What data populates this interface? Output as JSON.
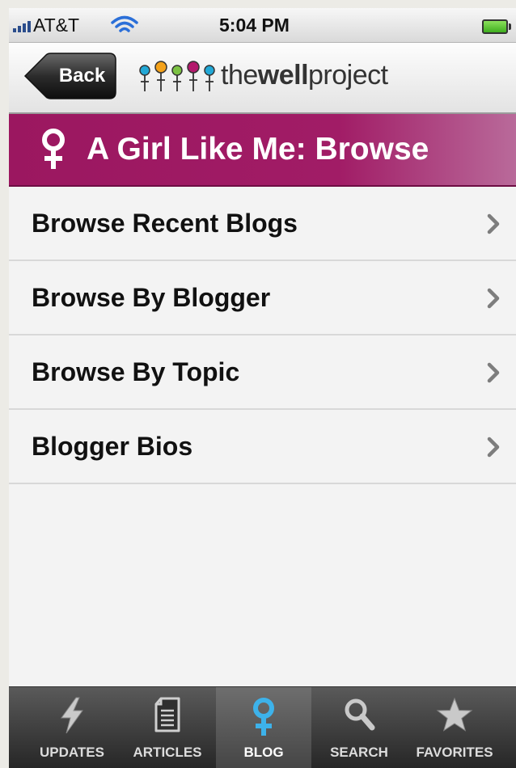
{
  "status_bar": {
    "carrier": "AT&T",
    "time": "5:04 PM"
  },
  "nav": {
    "back_label": "Back",
    "logo_prefix": "the",
    "logo_bold": "well",
    "logo_suffix": "project"
  },
  "section": {
    "title": "A Girl Like Me: Browse",
    "color": "#a11c66"
  },
  "list": {
    "items": [
      {
        "label": "Browse Recent Blogs"
      },
      {
        "label": "Browse By Blogger"
      },
      {
        "label": "Browse By Topic"
      },
      {
        "label": "Blogger Bios"
      }
    ]
  },
  "tabbar": {
    "tabs": [
      {
        "label": "UPDATES",
        "icon": "lightning-icon"
      },
      {
        "label": "ARTICLES",
        "icon": "document-icon"
      },
      {
        "label": "BLOG",
        "icon": "venus-icon",
        "selected": true
      },
      {
        "label": "SEARCH",
        "icon": "search-icon"
      },
      {
        "label": "FAVORITES",
        "icon": "star-icon"
      }
    ]
  }
}
